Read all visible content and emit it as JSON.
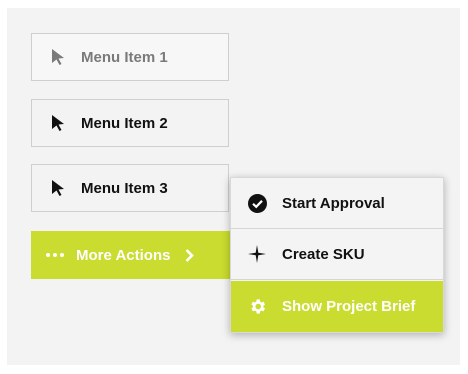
{
  "menu": {
    "items": [
      {
        "label": "Menu Item 1",
        "icon": "cursor-arrow-icon",
        "state": "disabled"
      },
      {
        "label": "Menu Item 2",
        "icon": "cursor-arrow-icon",
        "state": "normal"
      },
      {
        "label": "Menu Item 3",
        "icon": "cursor-arrow-icon",
        "state": "normal"
      }
    ],
    "more_actions": {
      "label": "More Actions",
      "icon": "dots-icon",
      "chevron": "chevron-right-icon"
    }
  },
  "dropdown": {
    "items": [
      {
        "label": "Start Approval",
        "icon": "check-circle-icon"
      },
      {
        "label": "Create SKU",
        "icon": "sparkle-icon"
      },
      {
        "label": "Show Project Brief",
        "icon": "gear-icon",
        "highlighted": true
      }
    ]
  },
  "colors": {
    "accent": "#c9dc2f",
    "panel_bg": "#f3f3f3",
    "text": "#111111",
    "disabled_text": "#7a7a7a"
  }
}
